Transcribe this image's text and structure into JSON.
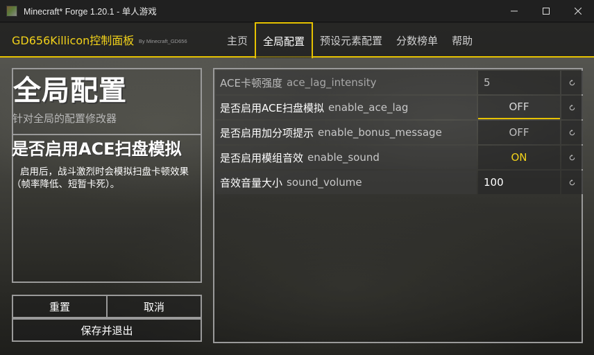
{
  "window": {
    "title": "Minecraft* Forge 1.20.1 - 单人游戏",
    "controls": {
      "minimize_icon": "minimize-icon",
      "maximize_icon": "maximize-icon",
      "close_icon": "close-icon"
    }
  },
  "header": {
    "brand": "GD656Killicon控制面板",
    "brand_sub": "By Minecraft_GD656",
    "tabs": [
      {
        "label": "主页",
        "active": false
      },
      {
        "label": "全局配置",
        "active": true
      },
      {
        "label": "预设元素配置",
        "active": false
      },
      {
        "label": "分数榜单",
        "active": false
      },
      {
        "label": "帮助",
        "active": false
      }
    ]
  },
  "left": {
    "title": "全局配置",
    "subtitle": "针对全局的配置修改器",
    "detail_title": "是否启用ACE扫盘模拟",
    "detail_body": "启用后，战斗激烈时会模拟扫盘卡顿效果（帧率降低、短暂卡死）。"
  },
  "buttons": {
    "reset": "重置",
    "cancel": "取消",
    "save_exit": "保存并退出"
  },
  "settings": [
    {
      "label": "ACE卡顿强度",
      "key": "ace_lag_intensity",
      "value": "5",
      "kind": "text",
      "enabled": false
    },
    {
      "label": "是否启用ACE扫盘模拟",
      "key": "enable_ace_lag",
      "value": "OFF",
      "kind": "toggle",
      "enabled": true
    },
    {
      "label": "是否启用加分项提示",
      "key": "enable_bonus_message",
      "value": "OFF",
      "kind": "toggle",
      "enabled": true
    },
    {
      "label": "是否启用模组音效",
      "key": "enable_sound",
      "value": "ON",
      "kind": "toggle",
      "enabled": true
    },
    {
      "label": "音效音量大小",
      "key": "sound_volume",
      "value": "100",
      "kind": "text",
      "enabled": true
    }
  ],
  "reset_icon": "reset-arrow-icon",
  "colors": {
    "accent": "#e6c200",
    "on": "#f2d21a"
  }
}
